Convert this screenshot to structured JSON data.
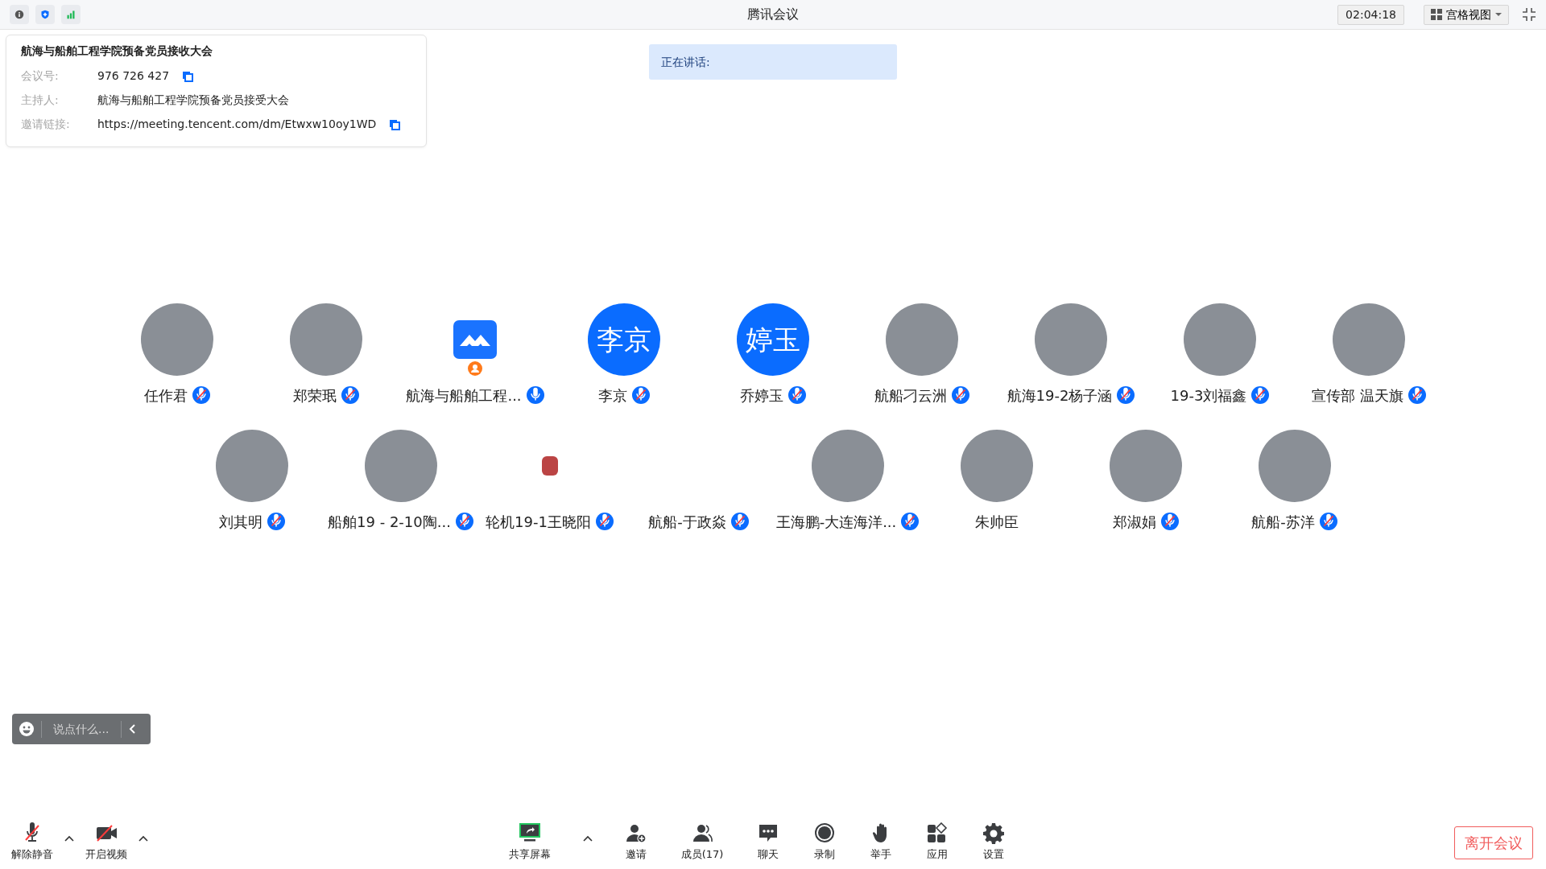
{
  "title_bar": {
    "icons": [
      {
        "kind": "info"
      },
      {
        "kind": "shield"
      },
      {
        "kind": "signal"
      }
    ],
    "title": "腾讯会议",
    "time": "02:04:18",
    "view_selector": "宫格视图"
  },
  "meeting_info": {
    "title": "航海与船舶工程学院预备党员接收大会",
    "fields": [
      {
        "label": "会议号:",
        "value": "976 726 427",
        "copy": true
      },
      {
        "label": "主持人:",
        "value": "航海与船舶工程学院预备党员接受大会",
        "copy": false
      },
      {
        "label": "邀请链接:",
        "value": "https://meeting.tencent.com/dm/Etwxw10oy1WD",
        "copy": true
      }
    ]
  },
  "speaking": {
    "label": "正在讲话:"
  },
  "participant_rows": [
    [
      {
        "name": "任作君",
        "kind": "photo",
        "muted": true,
        "host": false
      },
      {
        "name": "郑荣珉",
        "kind": "photo",
        "muted": true,
        "host": false
      },
      {
        "name": "航海与船舶工程...",
        "kind": "app-logo",
        "muted": false,
        "host": true
      },
      {
        "name": "李京",
        "kind": "initials",
        "initials": "李京",
        "muted": true,
        "host": false
      },
      {
        "name": "乔婷玉",
        "kind": "initials",
        "initials": "婷玉",
        "muted": true,
        "host": false
      },
      {
        "name": "航船刁云洲",
        "kind": "photo",
        "muted": true,
        "host": false
      },
      {
        "name": "航海19-2杨子涵",
        "kind": "photo",
        "muted": true,
        "host": false
      },
      {
        "name": "19-3刘福鑫",
        "kind": "photo",
        "muted": true,
        "host": false
      },
      {
        "name": "宣传部 温天旗",
        "kind": "photo",
        "muted": true,
        "host": false
      }
    ],
    [
      {
        "name": "刘其明",
        "kind": "photo",
        "muted": true,
        "host": false
      },
      {
        "name": "船舶19 - 2-10陶...",
        "kind": "photo",
        "muted": true,
        "host": false
      },
      {
        "name": "轮机19-1王晓阳",
        "kind": "sticker",
        "muted": true,
        "host": false
      },
      {
        "name": "航船-于政焱",
        "kind": "none",
        "muted": true,
        "host": false
      },
      {
        "name": "王海鹏-大连海洋...",
        "kind": "photo",
        "muted": true,
        "host": false
      },
      {
        "name": "朱帅臣",
        "kind": "photo",
        "host": false
      },
      {
        "name": "郑淑娟",
        "kind": "photo",
        "muted": true,
        "host": false
      },
      {
        "name": "航船-苏洋",
        "kind": "photo",
        "muted": true,
        "host": false
      }
    ]
  ],
  "chat_input": {
    "placeholder": "说点什么..."
  },
  "toolbar": {
    "left": [
      {
        "label": "解除静音",
        "kind": "mic-muted",
        "caret": true
      },
      {
        "label": "开启视频",
        "kind": "camera-off",
        "caret": true
      }
    ],
    "center": [
      {
        "label": "共享屏幕",
        "kind": "share-screen",
        "caret": true
      },
      {
        "label": "邀请",
        "kind": "invite",
        "caret": false
      },
      {
        "label": "成员(17)",
        "kind": "members",
        "caret": false
      },
      {
        "label": "聊天",
        "kind": "chat",
        "caret": false
      },
      {
        "label": "录制",
        "kind": "record",
        "caret": false
      },
      {
        "label": "举手",
        "kind": "hand",
        "caret": false
      },
      {
        "label": "应用",
        "kind": "apps",
        "caret": false
      },
      {
        "label": "设置",
        "kind": "settings",
        "caret": false
      }
    ],
    "leave_button": "离开会议"
  }
}
